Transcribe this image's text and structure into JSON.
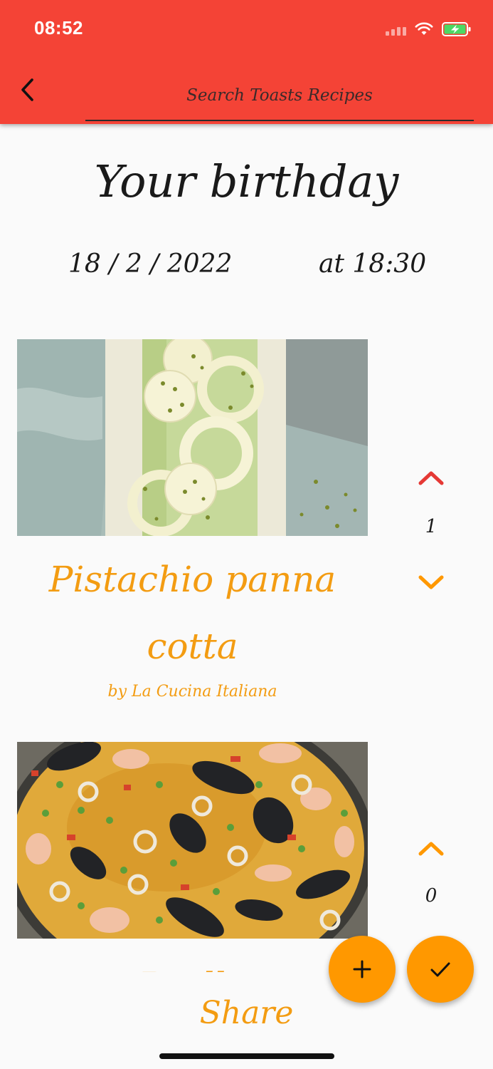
{
  "status_bar": {
    "time": "08:52",
    "icons": [
      "signal-icon",
      "wifi-icon",
      "battery-charging-icon"
    ]
  },
  "app_bar": {
    "back_icon": "chevron-left-icon",
    "search_placeholder": "Search Toasts Recipes"
  },
  "event": {
    "title": "Your birthday",
    "date": "18 / 2 / 2022",
    "time": "at 18:30"
  },
  "recipes": [
    {
      "title": "Pistachio panna cotta",
      "author": "by La Cucina Italiana",
      "votes": "1",
      "up_icon": "chevron-up-icon",
      "down_icon": "chevron-down-icon",
      "up_color": "#e53935",
      "down_color": "#ff9800"
    },
    {
      "title": "Paella",
      "votes": "0",
      "up_icon": "chevron-up-icon",
      "up_color": "#ff9800"
    }
  ],
  "actions": {
    "add_icon": "plus-icon",
    "confirm_icon": "check-icon",
    "share_label": "Share"
  },
  "colors": {
    "app_bar": "#f44336",
    "accent": "#ff9800",
    "recipe_text": "#f39c12",
    "background": "#fafafa"
  }
}
